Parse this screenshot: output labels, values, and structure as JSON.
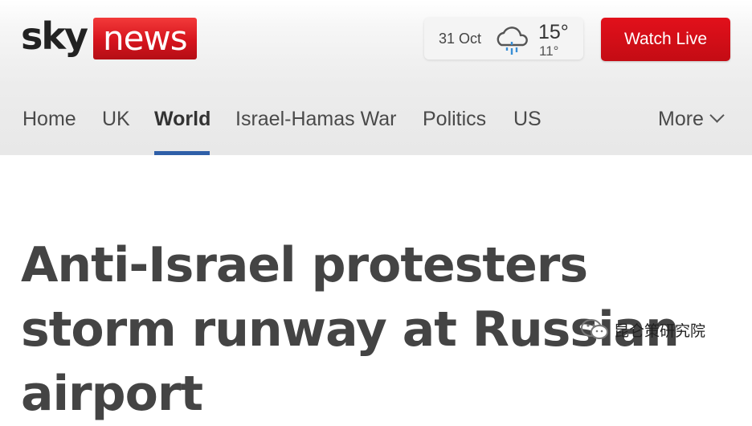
{
  "header": {
    "logo": {
      "sky": "sky",
      "news": "news"
    },
    "weather": {
      "date": "31 Oct",
      "high": "15°",
      "low": "11°",
      "icon": "rain-cloud-icon"
    },
    "watch_live_label": "Watch Live"
  },
  "nav": {
    "items": [
      {
        "label": "Home"
      },
      {
        "label": "UK"
      },
      {
        "label": "World",
        "active": true
      },
      {
        "label": "Israel-Hamas War"
      },
      {
        "label": "Politics"
      },
      {
        "label": "US"
      }
    ],
    "more_label": "More"
  },
  "article": {
    "headline": "Anti-Israel protesters storm runway at Russian airport"
  },
  "watermark": {
    "text": "昆仑策研究院"
  },
  "colors": {
    "brand_red": "#d6141d",
    "nav_accent": "#2f5fa8"
  }
}
